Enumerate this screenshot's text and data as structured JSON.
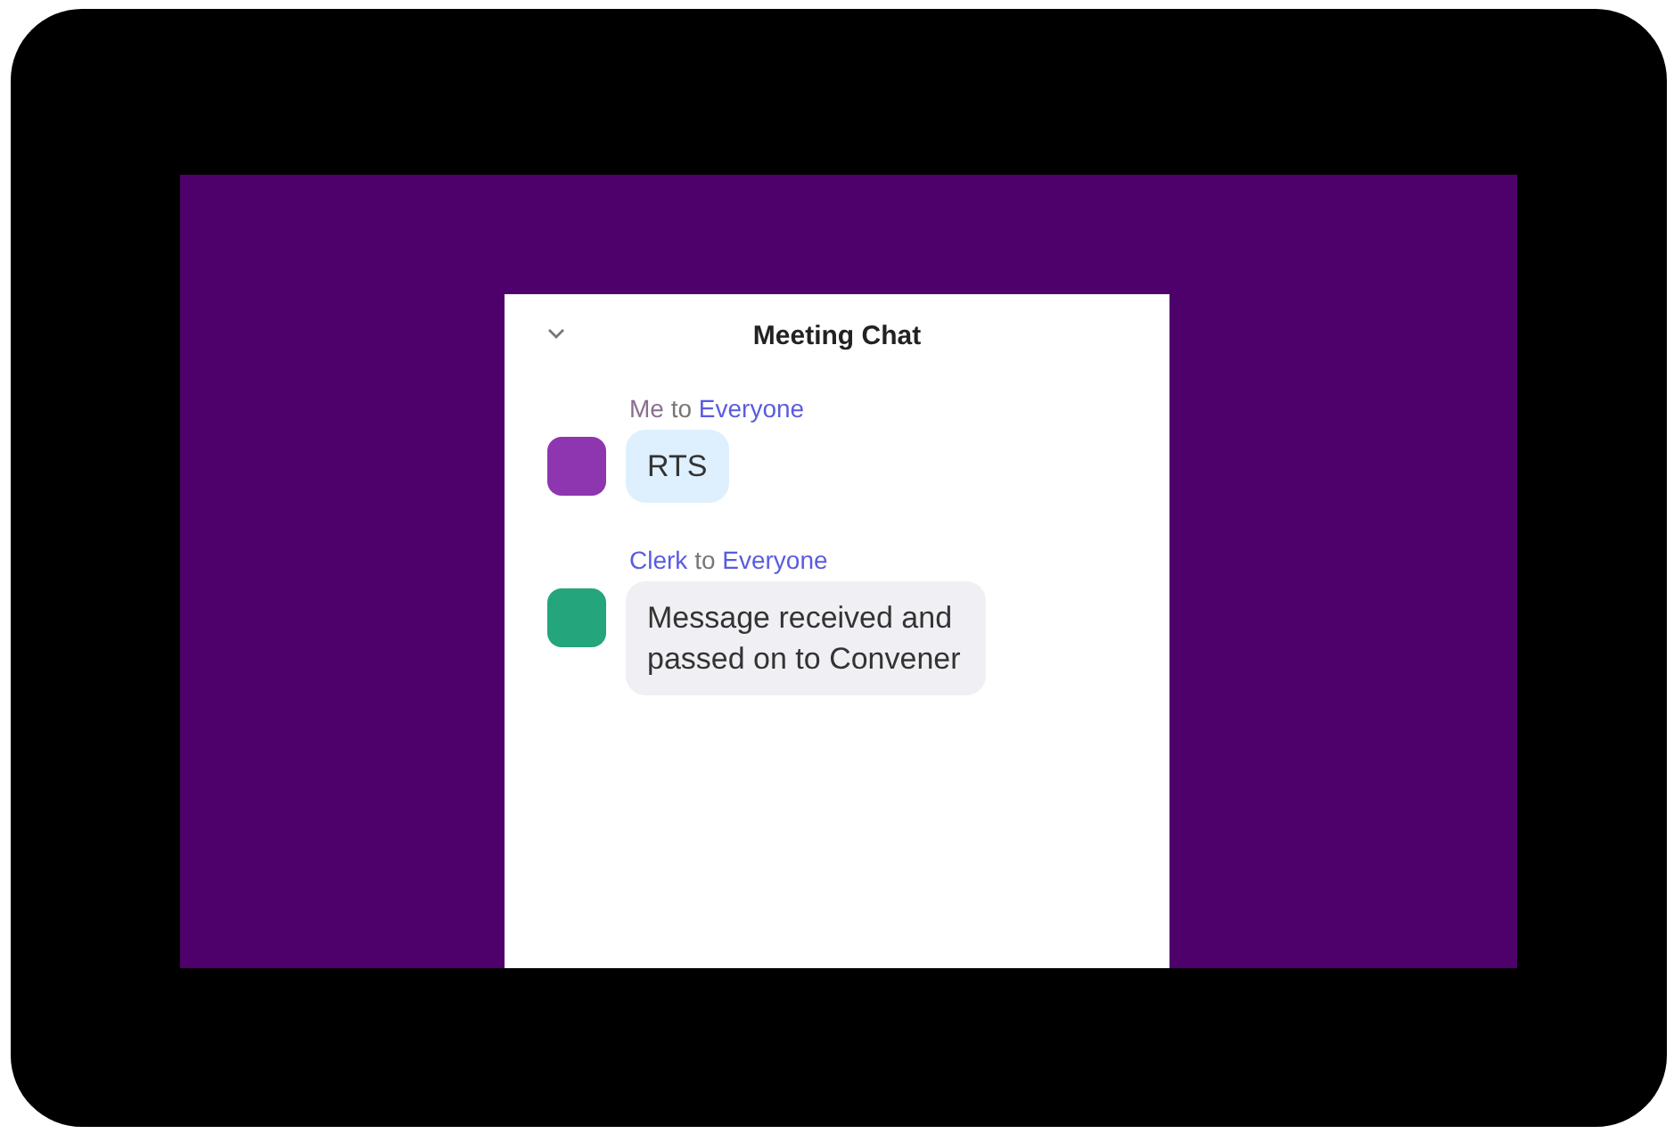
{
  "panel": {
    "title": "Meeting Chat"
  },
  "messages": [
    {
      "sender": "Me",
      "to": "to",
      "recipient": "Everyone",
      "self": true,
      "color": "#8e35b0",
      "text": "RTS"
    },
    {
      "sender": "Clerk",
      "to": "to",
      "recipient": "Everyone",
      "self": false,
      "color": "#24a57c",
      "text": "Message received and passed on to Convener"
    }
  ]
}
